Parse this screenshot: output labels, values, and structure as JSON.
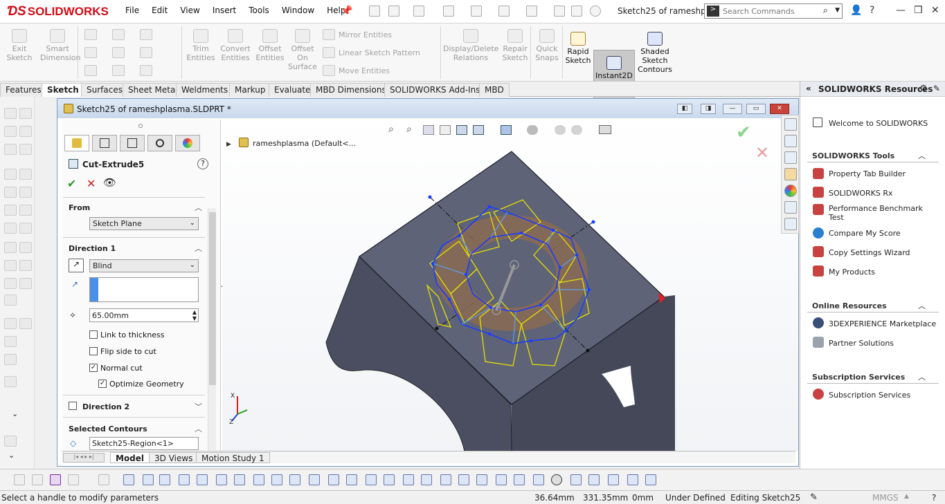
{
  "app": {
    "logo": "SOLIDWORKS",
    "document_title": "Sketch25 of rameshpl..."
  },
  "menu": [
    "File",
    "Edit",
    "View",
    "Insert",
    "Tools",
    "Window",
    "Help"
  ],
  "search": {
    "placeholder": "Search Commands"
  },
  "command_manager": {
    "exit_sketch": "Exit Sketch",
    "smart_dimension": "Smart Dimension",
    "trim_entities": "Trim Entities",
    "convert_entities": "Convert Entities",
    "offset_entities": "Offset Entities",
    "offset_on_surface": "Offset On Surface",
    "mirror_entities": "Mirror Entities",
    "linear_sketch_pattern": "Linear Sketch Pattern",
    "move_entities": "Move Entities",
    "display_delete_relations": "Display/Delete Relations",
    "repair_sketch": "Repair Sketch",
    "quick_snaps": "Quick Snaps",
    "rapid_sketch": "Rapid Sketch",
    "instant2d": "Instant2D",
    "shaded_sketch_contours": "Shaded Sketch Contours"
  },
  "tabs": [
    "Features",
    "Sketch",
    "Surfaces",
    "Sheet Metal",
    "Weldments",
    "Markup",
    "Evaluate",
    "MBD Dimensions",
    "SOLIDWORKS Add-Ins",
    "MBD"
  ],
  "document": {
    "window_title": "Sketch25 of rameshplasma.SLDPRT *",
    "tree_root": "rameshplasma  (Default<..."
  },
  "property_manager": {
    "feature_name": "Cut-Extrude5",
    "from": {
      "header": "From",
      "value": "Sketch Plane"
    },
    "direction1": {
      "header": "Direction 1",
      "end_condition": "Blind",
      "depth": "65.00mm"
    },
    "link_to_thickness": "Link to thickness",
    "flip_side_to_cut": "Flip side to cut",
    "normal_cut": "Normal cut",
    "optimize_geometry": "Optimize Geometry",
    "direction2": "Direction 2",
    "selected_contours": {
      "header": "Selected Contours",
      "value": "Sketch25-Region<1>"
    }
  },
  "bottom_tabs": [
    "Model",
    "3D Views",
    "Motion Study 1"
  ],
  "resources": {
    "title": "SOLIDWORKS Resources",
    "welcome": "Welcome to SOLIDWORKS",
    "tools_header": "SOLIDWORKS Tools",
    "tools": [
      "Property Tab Builder",
      "SOLIDWORKS Rx",
      "Performance Benchmark Test",
      "Compare My Score",
      "Copy Settings Wizard",
      "My Products"
    ],
    "online_header": "Online Resources",
    "online": [
      "3DEXPERIENCE Marketplace",
      "Partner Solutions"
    ],
    "subscription_header": "Subscription Services",
    "subscription": [
      "Subscription Services"
    ]
  },
  "status": {
    "message": "Select a handle to modify parameters",
    "x": "36.64mm",
    "y": "331.35mm",
    "z": "0mm",
    "definition": "Under Defined",
    "editing": "Editing Sketch25",
    "units": "MMGS"
  },
  "colors": {
    "brand_red": "#d40a14",
    "sketch_blue": "#1a3cff",
    "preview_yellow": "#e8e000",
    "part_gray": "#4a4e60"
  }
}
